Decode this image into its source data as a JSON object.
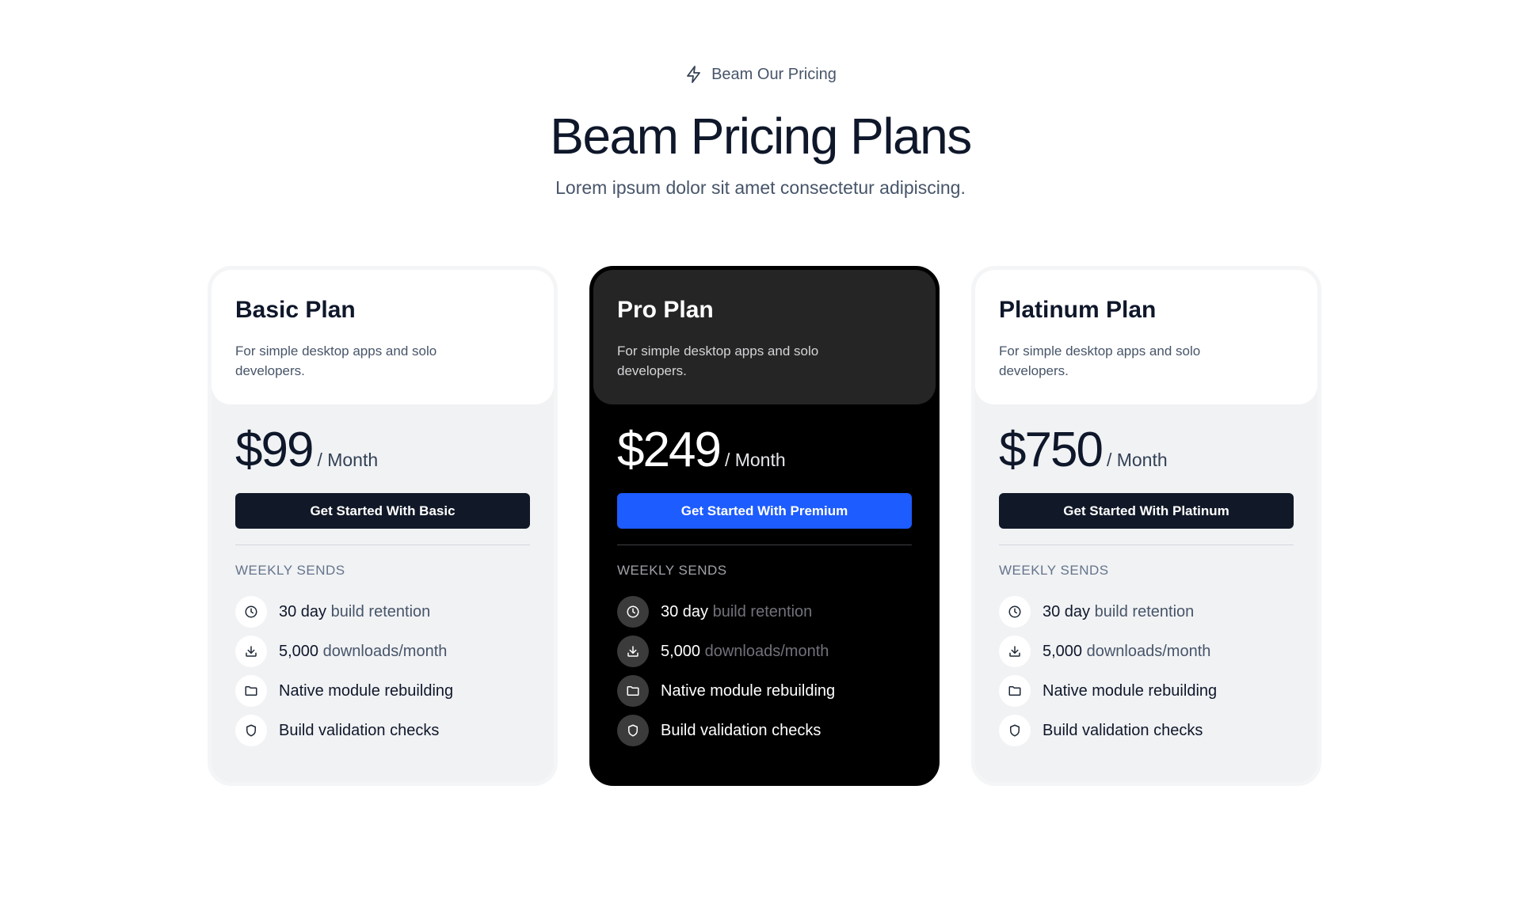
{
  "eyebrow": {
    "icon": "lightning-icon",
    "text": "Beam Our Pricing"
  },
  "title": "Beam Pricing Plans",
  "subtitle": "Lorem ipsum dolor sit amet consectetur adipiscing.",
  "colors": {
    "primary_dark": "#111827",
    "accent_blue": "#1d5cff",
    "card_light_bg": "#f1f2f4",
    "card_dark_bg": "#000000"
  },
  "plans": [
    {
      "name": "Basic Plan",
      "description": "For simple desktop apps and solo developers.",
      "price": "$99",
      "period": "/ Month",
      "cta": "Get Started With Basic",
      "section_label": "WEEKLY SENDS",
      "features": [
        {
          "icon": "clock-icon",
          "strong": "30 day",
          "muted": " build retention"
        },
        {
          "icon": "download-icon",
          "strong": "5,000",
          "muted": " downloads/month"
        },
        {
          "icon": "folder-icon",
          "strong": "Native module rebuilding",
          "muted": ""
        },
        {
          "icon": "shield-icon",
          "strong": "Build validation checks",
          "muted": ""
        }
      ]
    },
    {
      "name": "Pro Plan",
      "description": "For simple desktop apps and solo developers.",
      "price": "$249",
      "period": "/ Month",
      "cta": "Get Started With Premium",
      "section_label": "WEEKLY SENDS",
      "features": [
        {
          "icon": "clock-icon",
          "strong": "30 day",
          "muted": " build retention"
        },
        {
          "icon": "download-icon",
          "strong": "5,000",
          "muted": " downloads/month"
        },
        {
          "icon": "folder-icon",
          "strong": "Native module rebuilding",
          "muted": ""
        },
        {
          "icon": "shield-icon",
          "strong": "Build validation checks",
          "muted": ""
        }
      ]
    },
    {
      "name": "Platinum Plan",
      "description": "For simple desktop apps and solo developers.",
      "price": "$750",
      "period": "/ Month",
      "cta": "Get Started With Platinum",
      "section_label": "WEEKLY SENDS",
      "features": [
        {
          "icon": "clock-icon",
          "strong": "30 day",
          "muted": " build retention"
        },
        {
          "icon": "download-icon",
          "strong": "5,000",
          "muted": " downloads/month"
        },
        {
          "icon": "folder-icon",
          "strong": "Native module rebuilding",
          "muted": ""
        },
        {
          "icon": "shield-icon",
          "strong": "Build validation checks",
          "muted": ""
        }
      ]
    }
  ]
}
